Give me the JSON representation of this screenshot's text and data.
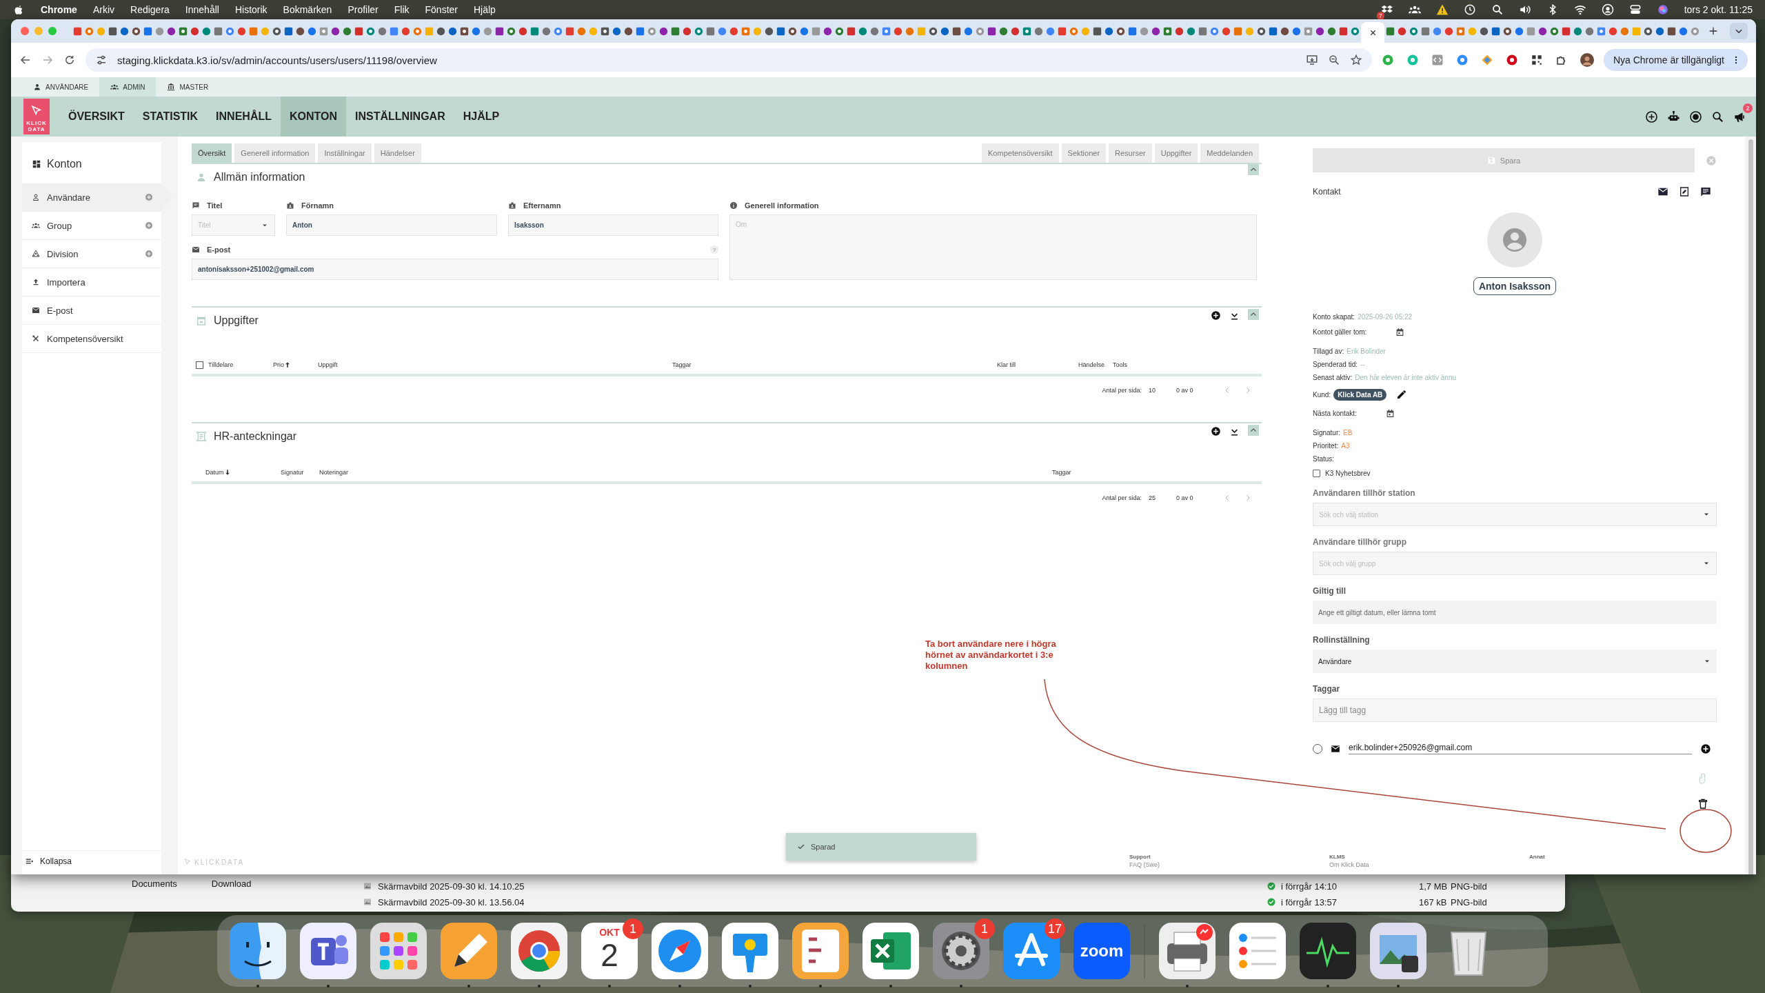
{
  "menu_bar": {
    "app": "Chrome",
    "items": [
      "Arkiv",
      "Redigera",
      "Innehåll",
      "Historik",
      "Bokmärken",
      "Profiler",
      "Flik",
      "Fönster",
      "Hjälp"
    ],
    "badge": "7",
    "clock": "tors 2 okt. 11:25"
  },
  "browser": {
    "url": "staging.klickdata.k3.io/sv/admin/accounts/users/users/11198/overview",
    "update": "Nya Chrome är tillgängligt"
  },
  "roles": [
    {
      "label": "ANVÄNDARE",
      "selected": false
    },
    {
      "label": "ADMIN",
      "selected": true
    },
    {
      "label": "MASTER",
      "selected": false
    }
  ],
  "logo": [
    "KLICK",
    "DATA"
  ],
  "nav": [
    {
      "label": "ÖVERSIKT",
      "selected": false
    },
    {
      "label": "STATISTIK",
      "selected": false
    },
    {
      "label": "INNEHÅLL",
      "selected": false
    },
    {
      "label": "KONTON",
      "selected": true
    },
    {
      "label": "INSTÄLLNINGAR",
      "selected": false
    },
    {
      "label": "HJÄLP",
      "selected": false
    }
  ],
  "notifications": "2",
  "sidebar": {
    "title": "Konton",
    "items": [
      {
        "kind": "user",
        "label": "Användare",
        "selected": true,
        "add": true
      },
      {
        "kind": "group",
        "label": "Group",
        "selected": false,
        "add": true
      },
      {
        "kind": "division",
        "label": "Division",
        "selected": false,
        "add": true
      },
      {
        "kind": "import",
        "label": "Importera",
        "selected": false,
        "add": false
      },
      {
        "kind": "mail",
        "label": "E-post",
        "selected": false,
        "add": false
      },
      {
        "kind": "tools",
        "label": "Kompetensöversikt",
        "selected": false,
        "add": false
      }
    ],
    "collapse": "Kollapsa"
  },
  "tabs": {
    "left": [
      {
        "label": "Översikt",
        "selected": true
      },
      {
        "label": "Generell information",
        "selected": false
      },
      {
        "label": "Inställningar",
        "selected": false
      },
      {
        "label": "Händelser",
        "selected": false
      }
    ],
    "right": [
      {
        "label": "Kompetensöversikt",
        "selected": false
      },
      {
        "label": "Sektioner",
        "selected": false
      },
      {
        "label": "Resurser",
        "selected": false
      },
      {
        "label": "Uppgifter",
        "selected": false
      },
      {
        "label": "Meddelanden",
        "selected": false
      }
    ]
  },
  "general": {
    "title": "Allmän information",
    "title_field": {
      "label": "Titel",
      "placeholder": "Titel"
    },
    "first_name": {
      "label": "Förnamn",
      "value": "Anton"
    },
    "last_name": {
      "label": "Efternamn",
      "value": "Isaksson"
    },
    "info": {
      "label": "Generell information",
      "placeholder": "Om"
    },
    "email": {
      "label": "E-post",
      "help": "?",
      "value": "antonisaksson+251002@gmail.com"
    }
  },
  "sections": [
    {
      "kind": "tasks",
      "title": "Uppgifter",
      "select_all_checked": false,
      "columns": [
        {
          "label": "Tilldelare",
          "sorted": false
        },
        {
          "label": "Prio",
          "sorted": true,
          "descending": false
        },
        {
          "label": "Uppgift",
          "sorted": false
        },
        {
          "label": "Taggar",
          "sorted": false
        },
        {
          "label": "Klar till",
          "sorted": false
        },
        {
          "label": "Händelse",
          "sorted": false
        },
        {
          "label": "Tools",
          "sorted": false
        }
      ],
      "per_page_label": "Antal per sida:",
      "per_page": "10",
      "range": "0 av 0"
    },
    {
      "kind": "notes",
      "title": "HR-anteckningar",
      "columns": [
        {
          "label": "Datum",
          "sorted": true,
          "descending": true
        },
        {
          "label": "Signatur",
          "sorted": false
        },
        {
          "label": "Noteringar",
          "sorted": false
        },
        {
          "label": "Taggar",
          "sorted": false
        }
      ],
      "per_page_label": "Antal per sida:",
      "per_page": "25",
      "range": "0 av 0"
    }
  ],
  "panel": {
    "save": "Spara",
    "contact": "Kontakt",
    "name": "Anton Isaksson",
    "info": [
      {
        "kind": "text",
        "label": "Konto skapat:",
        "value": "2025-09-26 05:22",
        "highlighted": false
      },
      {
        "kind": "date",
        "label": "Kontot gäller tom:"
      },
      {
        "kind": "text",
        "label": "Tillagd av:",
        "value": "Erik Bolinder",
        "highlighted": false
      },
      {
        "kind": "text",
        "label": "Spenderad tid:",
        "value": "--",
        "highlighted": false
      },
      {
        "kind": "text",
        "label": "Senast aktiv:",
        "value": "Den här eleven är inte aktiv ännu",
        "highlighted": false
      },
      {
        "kind": "chip",
        "label": "Kund:",
        "value": "Klick Data AB"
      },
      {
        "kind": "date",
        "label": "Nästa kontakt:"
      },
      {
        "kind": "text",
        "label": "Signatur:",
        "value": "EB",
        "highlighted": true
      },
      {
        "kind": "text",
        "label": "Prioritet:",
        "value": "A3",
        "highlighted": true
      },
      {
        "kind": "text",
        "label": "Status:"
      }
    ],
    "newsletter": {
      "label": "K3 Nyhetsbrev",
      "checked": false
    },
    "fields": [
      {
        "kind": "select",
        "label": "Användaren tillhör station",
        "placeholder": "Sök och välj station"
      },
      {
        "kind": "select",
        "label": "Användare tillhör grupp",
        "placeholder": "Sök och välj grupp"
      },
      {
        "kind": "input",
        "label": "Giltig till",
        "placeholder": "Ange ett giltigt datum, eller lämna tomt"
      },
      {
        "kind": "role",
        "label": "Rollinställning",
        "value": "Användare"
      },
      {
        "kind": "tags",
        "label": "Taggar",
        "placeholder": "Lägg till tagg"
      }
    ],
    "email": {
      "value": "erik.bolinder+250926@gmail.com",
      "selected": false
    }
  },
  "toast": "Sparad",
  "footer": {
    "brand": "KLICKDATA",
    "columns": [
      {
        "title": "Support",
        "sub": "FAQ (Swe)"
      },
      {
        "title": "KLMS",
        "sub": "Om Klick Data"
      },
      {
        "title": "Annat"
      }
    ]
  },
  "annotation": "Ta bort användare nere i högra hörnet av användarkortet i 3:e kolumnen",
  "finder": {
    "places": [
      "Documents",
      "Download"
    ],
    "files": [
      {
        "name": "Skärmavbild 2025-09-30 kl. 14.10.25",
        "date": "i förrgår 14:10",
        "size": "1,7 MB",
        "kind": "PNG-bild"
      },
      {
        "name": "Skärmavbild 2025-09-30 kl. 13.56.04",
        "date": "i förrgår 13:57",
        "size": "167 kB",
        "kind": "PNG-bild"
      }
    ]
  },
  "dock": [
    {
      "kind": "finder",
      "running": true
    },
    {
      "kind": "teams",
      "running": true
    },
    {
      "kind": "launchpad",
      "running": false
    },
    {
      "kind": "pen",
      "running": true
    },
    {
      "kind": "chrome",
      "running": true
    },
    {
      "kind": "calendar",
      "month": "OKT",
      "day": "2",
      "badge": "1",
      "running": true
    },
    {
      "kind": "safari",
      "running": true
    },
    {
      "kind": "keynote",
      "running": true
    },
    {
      "kind": "fontbook",
      "running": true
    },
    {
      "kind": "excel",
      "running": true
    },
    {
      "kind": "settings",
      "badge": "1",
      "running": true
    },
    {
      "kind": "appstore",
      "badge": "17",
      "running": false
    },
    {
      "kind": "zoom",
      "label": "zoom",
      "running": false
    },
    {
      "kind": "separator"
    },
    {
      "kind": "printer",
      "running": true
    },
    {
      "kind": "reminders",
      "running": false
    },
    {
      "kind": "activity",
      "running": true
    },
    {
      "kind": "preview",
      "running": true
    },
    {
      "kind": "trash",
      "running": false
    }
  ]
}
